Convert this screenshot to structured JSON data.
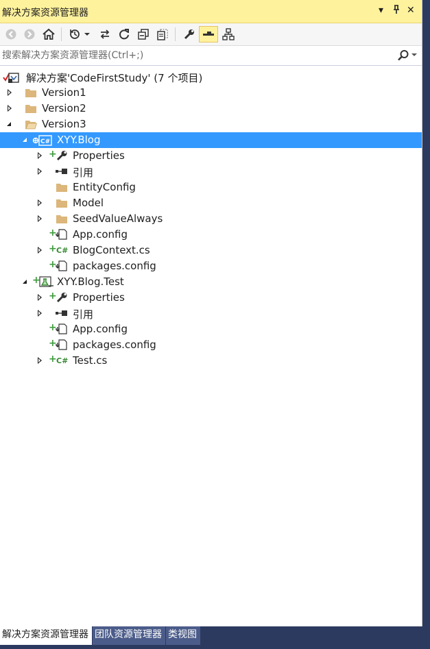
{
  "window": {
    "title": "解决方案资源管理器",
    "controls": {
      "dropdown": "▾",
      "pin": "⊓",
      "close": "✕"
    }
  },
  "toolbar": {
    "icons": [
      "back-icon",
      "forward-icon",
      "home-icon",
      "history-icon",
      "sync-icon",
      "refresh-icon",
      "collapse-all-icon",
      "show-all-files-icon",
      "properties-icon",
      "preview-icon",
      "class-diagram-icon"
    ]
  },
  "search": {
    "placeholder": "搜索解决方案资源管理器(Ctrl+;)",
    "value": ""
  },
  "tree": {
    "solution": "解决方案'CodeFirstStudy' (7 个项目)",
    "folders": [
      "Version1",
      "Version2",
      "Version3"
    ],
    "project1": {
      "name": "XYY.Blog",
      "items": [
        "Properties",
        "引用",
        "EntityConfig",
        "Model",
        "SeedValueAlways",
        "App.config",
        "BlogContext.cs",
        "packages.config"
      ]
    },
    "project2": {
      "name": "XYY.Blog.Test",
      "items": [
        "Properties",
        "引用",
        "App.config",
        "packages.config",
        "Test.cs"
      ]
    }
  },
  "tabs": [
    "解决方案资源管理器",
    "团队资源管理器",
    "类视图"
  ],
  "colors": {
    "title_bar": "#fff29d",
    "selection": "#3399ff",
    "folder": "#dcb67a",
    "csharp": "#388a34",
    "frame": "#2d3a60"
  }
}
